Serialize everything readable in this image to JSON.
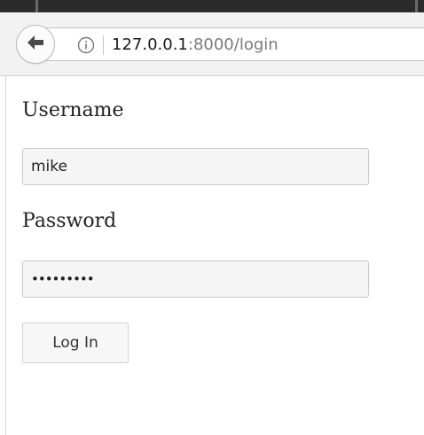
{
  "browser": {
    "url_host": "127.0.0.1",
    "url_rest": ":8000/login",
    "back_icon": "back-arrow-icon",
    "info_icon": "info-icon"
  },
  "form": {
    "username_label": "Username",
    "username_value": "mike",
    "password_label": "Password",
    "password_masked": "•••••••••",
    "login_label": "Log In"
  }
}
